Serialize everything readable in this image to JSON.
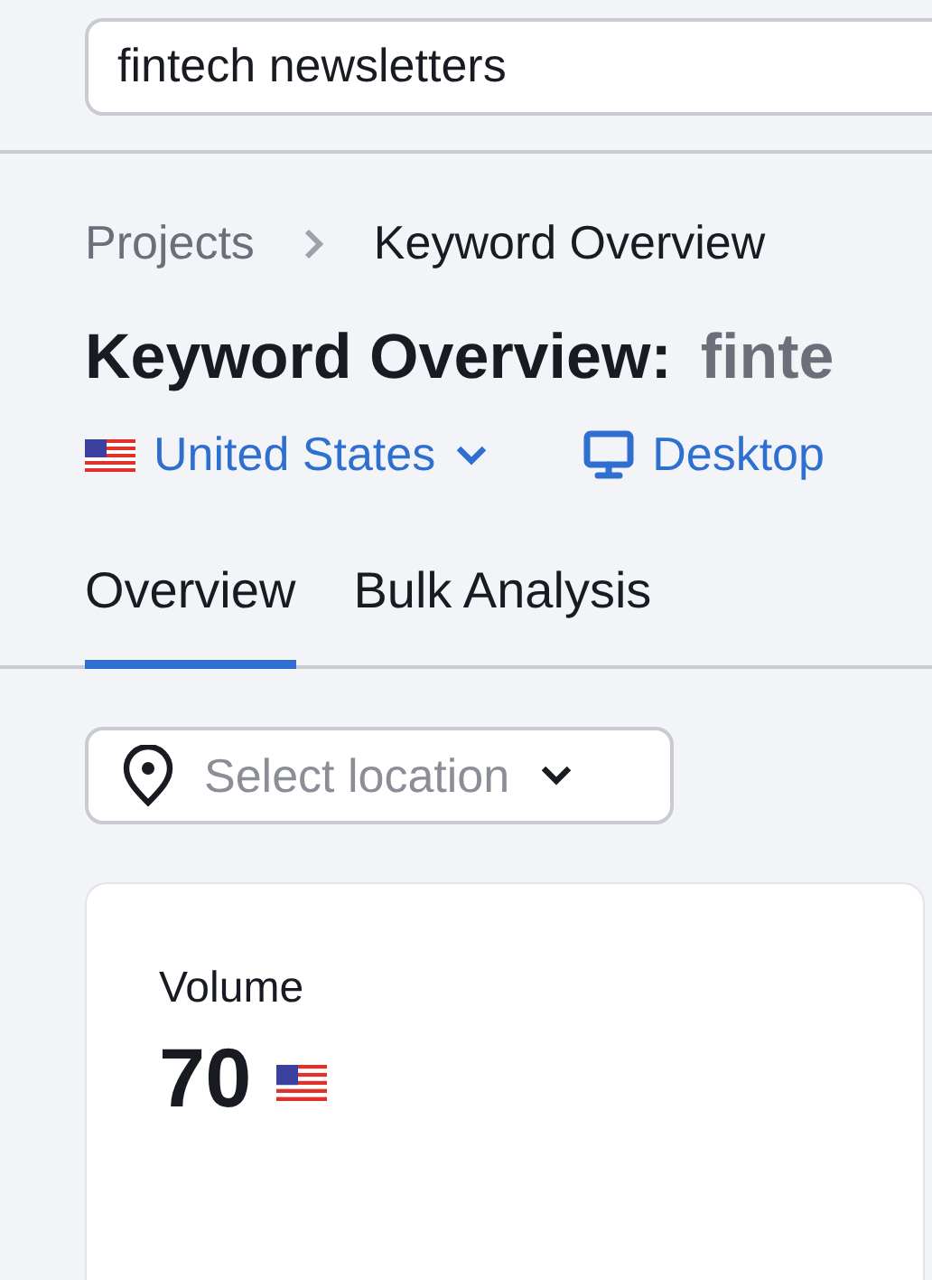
{
  "search": {
    "value": "fintech newsletters"
  },
  "breadcrumbs": [
    {
      "label": "Projects",
      "current": false
    },
    {
      "label": "Keyword Overview",
      "current": true
    }
  ],
  "title": {
    "text": "Keyword Overview:",
    "keyword": "finte"
  },
  "database": {
    "country": "United States"
  },
  "device": {
    "label": "Desktop"
  },
  "tabs": [
    {
      "label": "Overview",
      "selected": true
    },
    {
      "label": "Bulk Analysis",
      "selected": false
    }
  ],
  "location_select": {
    "placeholder": "Select location"
  },
  "volume_card": {
    "label": "Volume",
    "value": "70"
  }
}
